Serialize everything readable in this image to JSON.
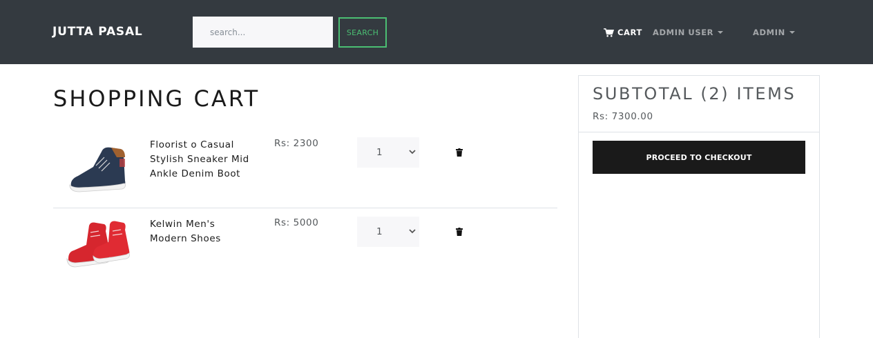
{
  "navbar": {
    "brand": "JUTTA PASAL",
    "search_placeholder": "search...",
    "search_button": "SEARCH",
    "cart_label": "CART",
    "admin_user_label": "ADMIN USER",
    "admin_label": "ADMIN"
  },
  "cart": {
    "title": "SHOPPING CART",
    "items": [
      {
        "name": "Floorist o Casual Stylish Sneaker Mid Ankle Denim Boot",
        "price": "Rs: 2300",
        "qty": "1",
        "image_icon": "denim-sneaker-icon"
      },
      {
        "name": "Kelwin Men's Modern Shoes",
        "price": "Rs: 5000",
        "qty": "1",
        "image_icon": "red-sneaker-icon"
      }
    ]
  },
  "summary": {
    "title": "SUBTOTAL (2) ITEMS",
    "amount": "Rs: 7300.00",
    "checkout_button": "PROCEED TO CHECKOUT"
  },
  "colors": {
    "navbar_bg": "#343a40",
    "accent_green": "#4bbf73",
    "checkout_bg": "#1a1a1a"
  }
}
